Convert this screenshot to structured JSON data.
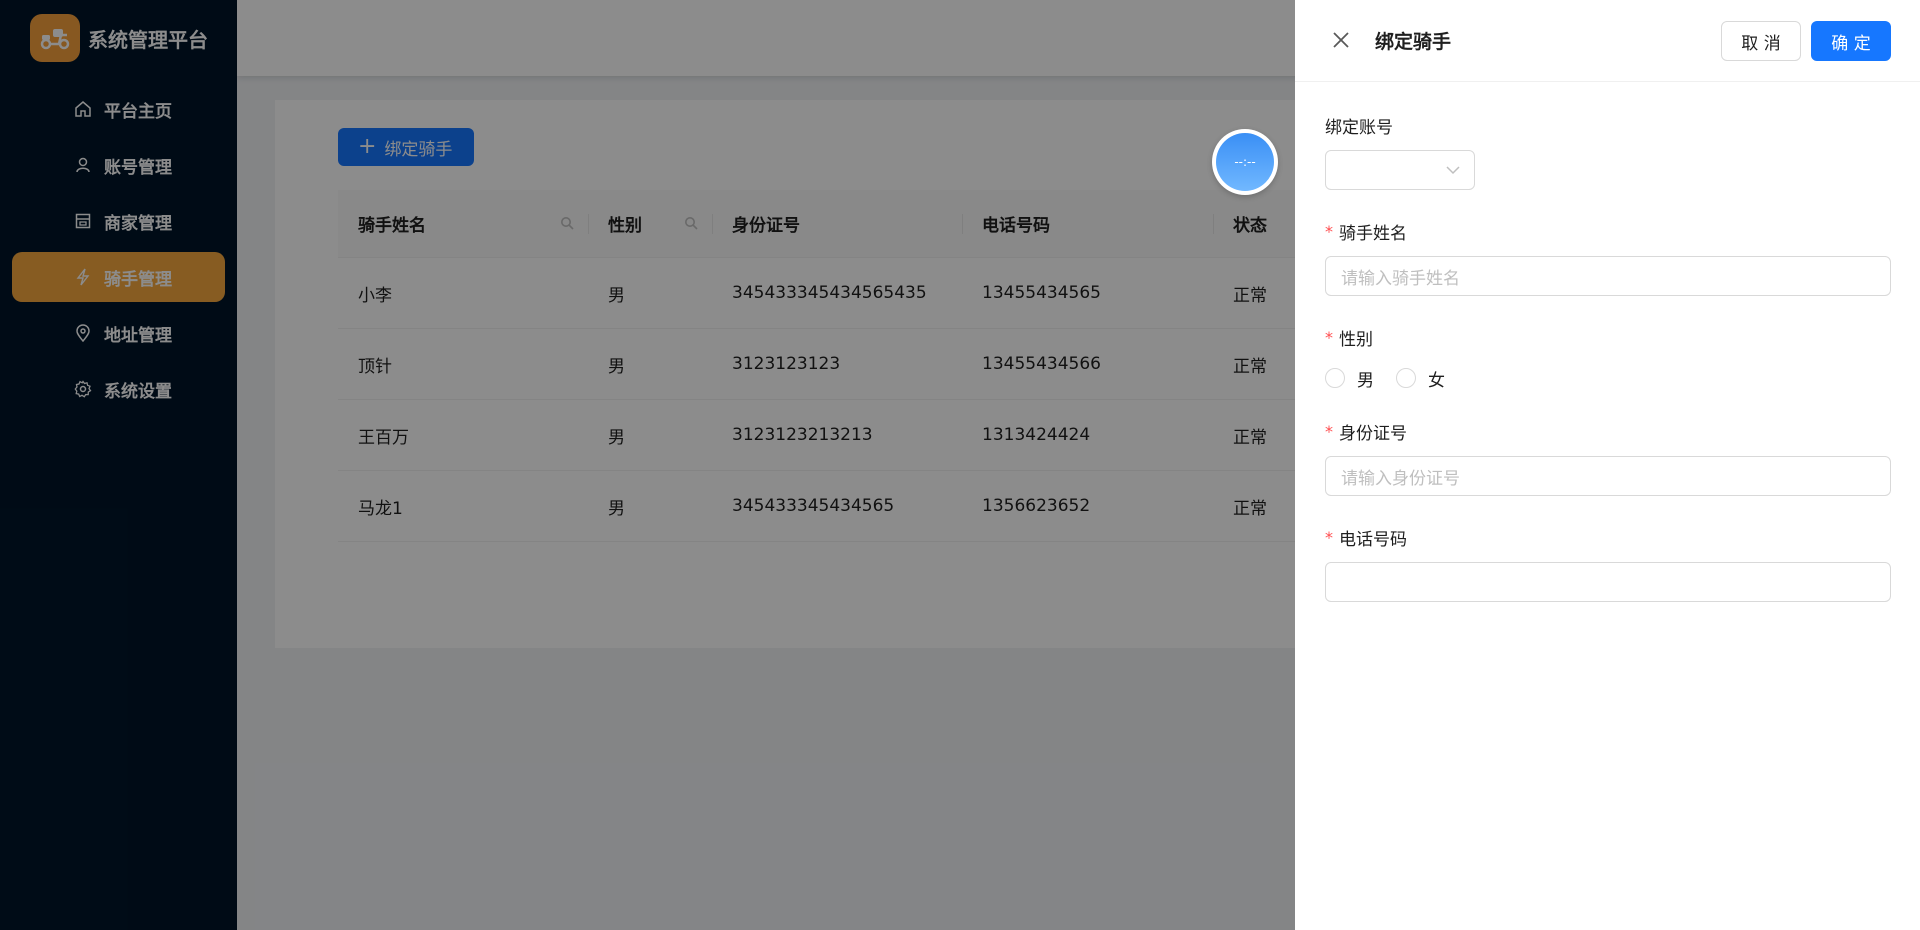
{
  "app": {
    "title": "系统管理平台"
  },
  "sidebar": {
    "items": [
      {
        "label": "平台主页",
        "icon": "home-icon",
        "active": false
      },
      {
        "label": "账号管理",
        "icon": "user-icon",
        "active": false
      },
      {
        "label": "商家管理",
        "icon": "shop-icon",
        "active": false
      },
      {
        "label": "骑手管理",
        "icon": "lightning-icon",
        "active": true
      },
      {
        "label": "地址管理",
        "icon": "location-icon",
        "active": false
      },
      {
        "label": "系统设置",
        "icon": "gear-icon",
        "active": false
      }
    ]
  },
  "main": {
    "add_button": "绑定骑手",
    "columns": [
      "骑手姓名",
      "性别",
      "身份证号",
      "电话号码",
      "状态"
    ],
    "rows": [
      [
        "小李",
        "男",
        "345433345434565435",
        "13455434565",
        "正常"
      ],
      [
        "顶针",
        "男",
        "3123123123",
        "13455434566",
        "正常"
      ],
      [
        "王百万",
        "男",
        "3123123213213",
        "1313424424",
        "正常"
      ],
      [
        "马龙1",
        "男",
        "345433345434565",
        "1356623652",
        "正常"
      ]
    ]
  },
  "float_widget": {
    "text": "--:--"
  },
  "drawer": {
    "title": "绑定骑手",
    "cancel": "取 消",
    "ok": "确 定",
    "fields": {
      "account": {
        "label": "绑定账号"
      },
      "name": {
        "label": "骑手姓名",
        "placeholder": "请输入骑手姓名"
      },
      "gender": {
        "label": "性别",
        "options": [
          "男",
          "女"
        ]
      },
      "idcard": {
        "label": "身份证号",
        "placeholder": "请输入身份证号"
      },
      "phone": {
        "label": "电话号码",
        "placeholder": ""
      }
    }
  },
  "colors": {
    "sidebar_bg": "#001529",
    "accent": "#f6a83f",
    "primary": "#1677ff",
    "required": "#ff4d4f"
  }
}
